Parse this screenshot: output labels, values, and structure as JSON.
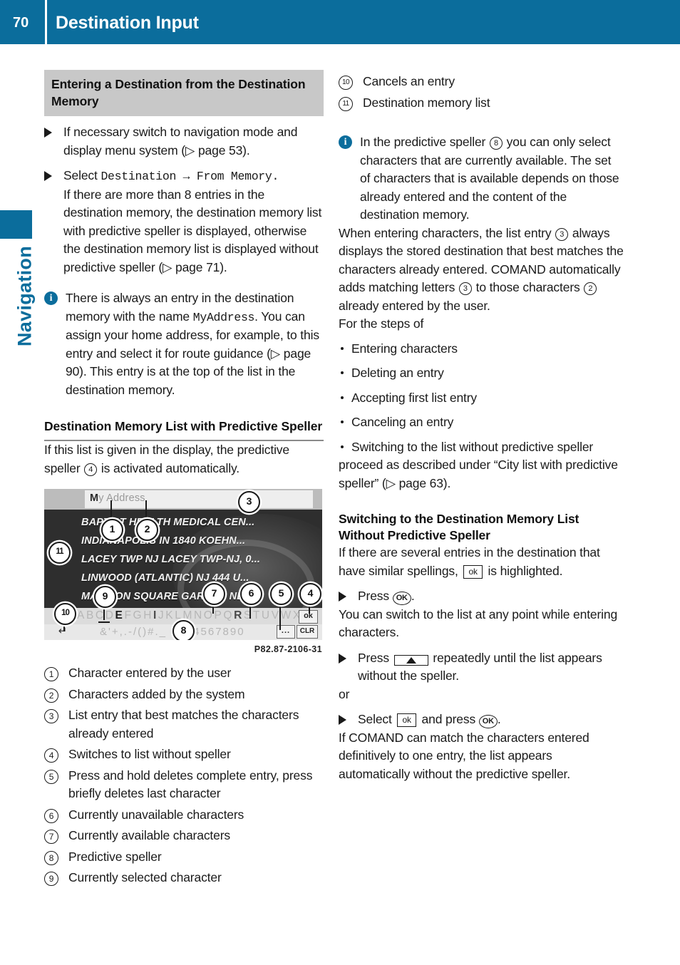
{
  "header": {
    "page_number": "70",
    "title": "Destination Input"
  },
  "sidetab": {
    "label": "Navigation"
  },
  "left": {
    "section_heading": "Entering a Destination from the Destination Memory",
    "step1": "If necessary switch to navigation mode and display menu system (▷ page 53).",
    "step2_lead": "Select ",
    "step2_cmd": "Destination → From Memory.",
    "step2_body": "If there are more than 8 entries in the destination memory, the destination memory list with predictive speller is displayed, otherwise the destination memory list is displayed without predictive speller (▷ page 71).",
    "info_pre": "There is always an entry in the destination memory with the name ",
    "info_cmd": "MyAddress",
    "info_post": ". You can assign your home address, for example, to this entry and select it for route guidance (▷ page 90). This entry is at the top of the list in the destination memory.",
    "subheading": "Destination Memory List with Predictive Speller",
    "intro_a": "If this list is given in the display, the predictive speller ",
    "intro_ref": "4",
    "intro_b": " is activated automatically.",
    "figure": {
      "search_field_entered": "M",
      "search_field_added": "y Address",
      "list_rows": [
        "BAPTIST HEALTH MEDICAL CEN...",
        "INDIANAPOLIS IN 1840 KOEHN...",
        "LACEY TWP NJ LACEY TWP-NJ, 0...",
        "LINWOOD (ATLANTIC) NJ 444 U...",
        "MADISON SQUARE GARDEN NE..."
      ],
      "keyboard_letters": "ABCDEFGHIJKLMNOPQRSTUVWXYZ",
      "keyboard_symbols": "&'+,.-/()#._ 1234567890",
      "key_ok": "ok",
      "key_clr": "CLR",
      "key_dots": "...",
      "key_back": "↵",
      "selected_character": "E",
      "available_characters": "E I R",
      "callouts": [
        "1",
        "2",
        "3",
        "4",
        "5",
        "6",
        "7",
        "8",
        "9",
        "10",
        "11"
      ],
      "caption": "P82.87-2106-31"
    },
    "legend": [
      {
        "num": "1",
        "text": "Character entered by the user"
      },
      {
        "num": "2",
        "text": "Characters added by the system"
      },
      {
        "num": "3",
        "text": "List entry that best matches the characters already entered"
      },
      {
        "num": "4",
        "text": "Switches to list without speller"
      },
      {
        "num": "5",
        "text": "Press and hold deletes complete entry, press briefly deletes last character"
      },
      {
        "num": "6",
        "text": "Currently unavailable characters"
      },
      {
        "num": "7",
        "text": "Currently available characters"
      },
      {
        "num": "8",
        "text": "Predictive speller"
      },
      {
        "num": "9",
        "text": "Currently selected character"
      }
    ]
  },
  "right": {
    "legend": [
      {
        "num": "10",
        "text": "Cancels an entry"
      },
      {
        "num": "11",
        "text": "Destination memory list"
      }
    ],
    "info_a": "In the predictive speller ",
    "info_ref": "8",
    "info_b": " you can only select characters that are currently available. The set of characters that is available depends on those already entered and the content of the destination memory.",
    "para1_a": "When entering characters, the list entry ",
    "para1_ref1": "3",
    "para1_b": " always displays the stored destination that best matches the characters already entered. COMAND automatically adds matching letters ",
    "para1_ref2": "3",
    "para1_c": " to those characters ",
    "para1_ref3": "2",
    "para1_d": " already entered by the user.",
    "for_steps": "For the steps of",
    "bullets": [
      "Entering characters",
      "Deleting an entry",
      "Accepting first list entry",
      "Canceling an entry",
      "Switching to the list without predictive speller"
    ],
    "proceed": "proceed as described under “City list with predictive speller” (▷ page 63).",
    "subheading": "Switching to the Destination Memory List Without Predictive Speller",
    "para2_a": "If there are several entries in the destination that have similar spellings, ",
    "para2_key": "ok",
    "para2_b": " is highlighted.",
    "step_press_a": "Press ",
    "step_press_ok": "OK",
    "step_press_b": ".",
    "para3": "You can switch to the list at any point while entering characters.",
    "step_press2_a": "Press ",
    "step_press2_b": " repeatedly until the list appears without the speller.",
    "or": "or",
    "step_select_a": "Select ",
    "step_select_key": "ok",
    "step_select_b": " and press ",
    "step_select_ok": "OK",
    "step_select_c": ".",
    "para4": "If COMAND can match the characters entered definitively to one entry, the list appears automatically without the predictive speller."
  }
}
